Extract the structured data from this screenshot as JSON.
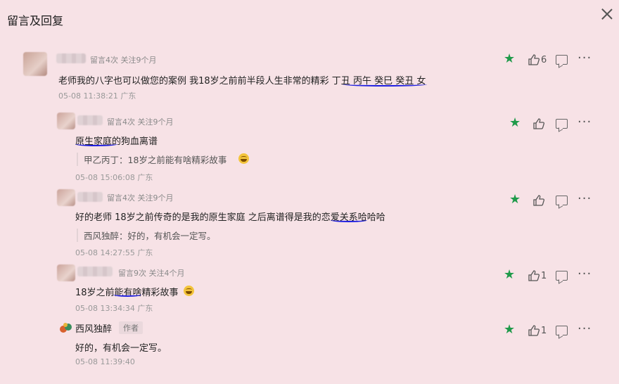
{
  "window": {
    "title": "留言及回复"
  },
  "comments": [
    {
      "meta": "留言4次 关注9个月",
      "text": "老师我的八字也可以做您的案例 我18岁之前前半段人生非常的精彩  丁丑 丙午 癸巳 癸丑  女",
      "time": "05-08 11:38:21 广东",
      "like_count": "6"
    },
    {
      "meta": "留言4次 关注9个月",
      "text": "原生家庭的狗血离谱",
      "quote": "甲乙丙丁：18岁之前能有啥精彩故事",
      "time": "05-08 15:06:08 广东"
    },
    {
      "meta": "留言4次 关注9个月",
      "text": "好的老师 18岁之前传奇的是我的原生家庭 之后离谱得是我的恋爱关系哈哈哈",
      "quote": "西风独醉：好的，有机会一定写。",
      "time": "05-08 14:27:55 广东"
    },
    {
      "meta": "留言9次 关注4个月",
      "text": "18岁之前能有啥精彩故事",
      "time": "05-08 13:34:34 广东",
      "like_count": "1"
    },
    {
      "name": "西风独醉",
      "badge": "作者",
      "text": "好的，有机会一定写。",
      "time": "05-08 11:39:40",
      "like_count": "1"
    }
  ],
  "icons": {
    "star": "star-icon",
    "like": "thumbs-up-icon",
    "reply": "comment-bubble-icon",
    "more": "more-icon"
  },
  "colors": {
    "star": "#1f9a4a",
    "underline": "#1e1ee0",
    "background": "#f7e2e6"
  }
}
